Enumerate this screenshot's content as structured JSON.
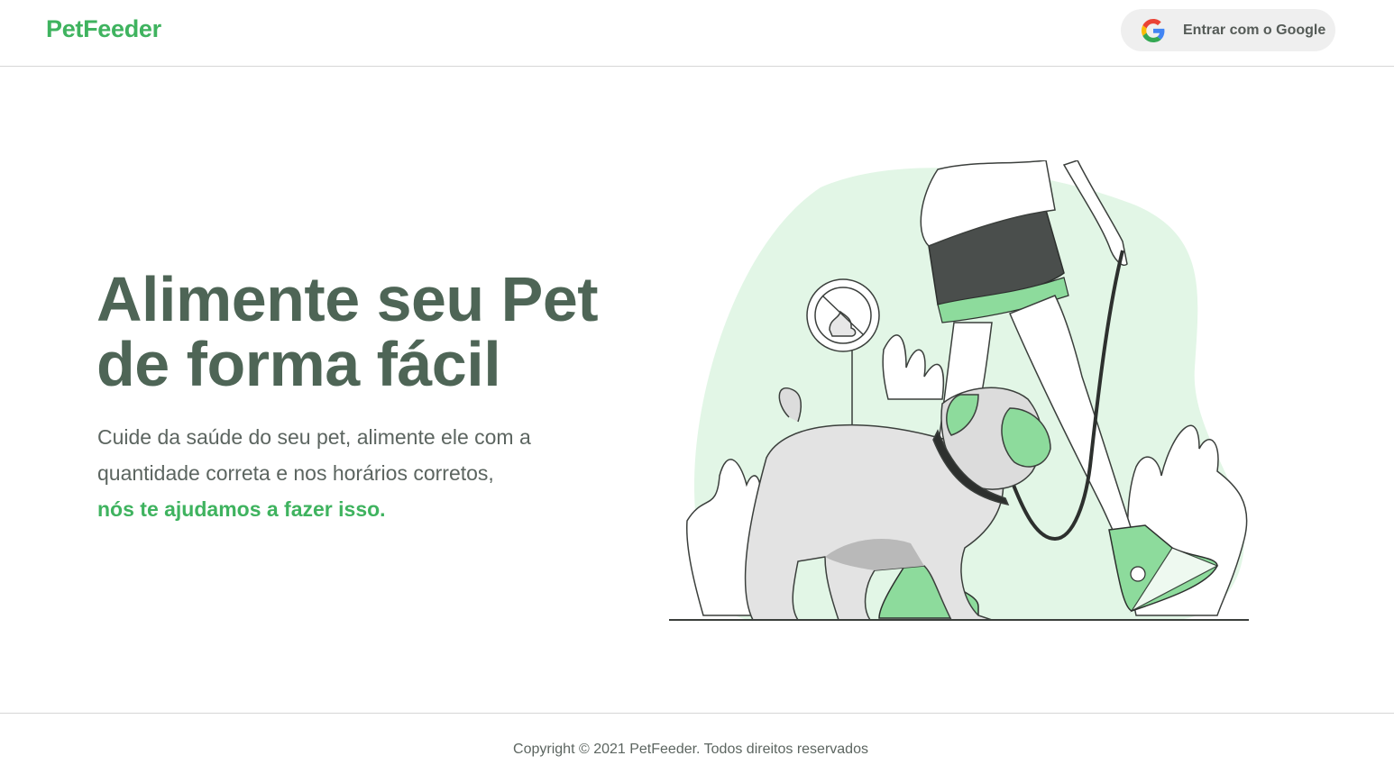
{
  "header": {
    "logo": "PetFeeder",
    "login_button": {
      "label": "Entrar com o Google",
      "icon": "google-icon"
    }
  },
  "hero": {
    "title_line1": "Alimente seu Pet",
    "title_line2": "de forma fácil",
    "text_line1": "Cuide da saúde do seu pet, alimente ele com a",
    "text_line2": "quantidade correta e nos horários corretos,",
    "text_accent": "nós te ajudamos a fazer isso.",
    "illustration": "person-walking-pug-illustration"
  },
  "footer": {
    "copyright": "Copyright © 2021 PetFeeder. Todos direitos reservados"
  },
  "colors": {
    "brand_green": "#3fb35f",
    "title_dark_green": "#4e6556",
    "body_text": "#5c6560",
    "illustration_bg": "#e2f6e6",
    "illustration_accent": "#8ddb9c"
  }
}
